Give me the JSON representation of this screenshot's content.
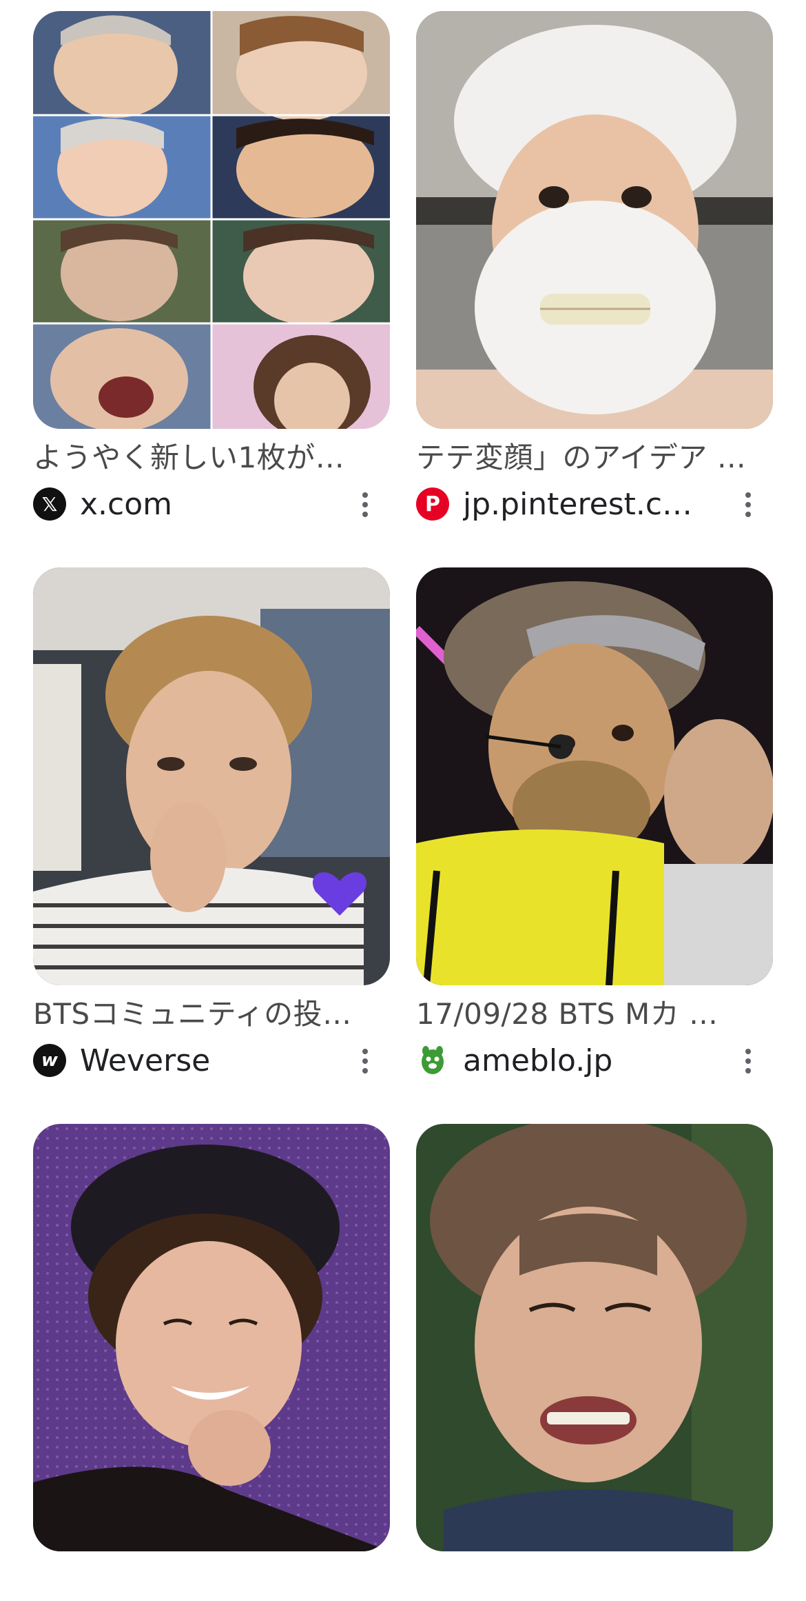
{
  "results": [
    {
      "title": "ようやく新しい1枚が…",
      "source": "x.com",
      "favicon_icon": "x-logo-icon",
      "image_desc_icon": "collage-faces-image"
    },
    {
      "title": "テテ変顔」のアイデア …",
      "source": "jp.pinterest.c…",
      "favicon_icon": "pinterest-logo-icon",
      "image_desc_icon": "beard-face-image"
    },
    {
      "title": "BTSコミュニティの投…",
      "source": "Weverse",
      "favicon_icon": "weverse-logo-icon",
      "image_desc_icon": "thinking-face-image"
    },
    {
      "title": "17/09/28 BTS Mカ …",
      "source": "ameblo.jp",
      "favicon_icon": "ameba-logo-icon",
      "image_desc_icon": "mic-face-image"
    },
    {
      "title": "",
      "source": "",
      "favicon_icon": "",
      "image_desc_icon": "smile-hat-image"
    },
    {
      "title": "",
      "source": "",
      "favicon_icon": "",
      "image_desc_icon": "grimace-face-image"
    }
  ],
  "favicon_glyphs": {
    "x": "𝕏",
    "pinterest": "P",
    "weverse": "w"
  },
  "colors": {
    "pinterest": "#e60023",
    "ameba_green": "#3d9b35",
    "text_gray": "#4a4a4a",
    "more_dots": "#5f6368"
  }
}
